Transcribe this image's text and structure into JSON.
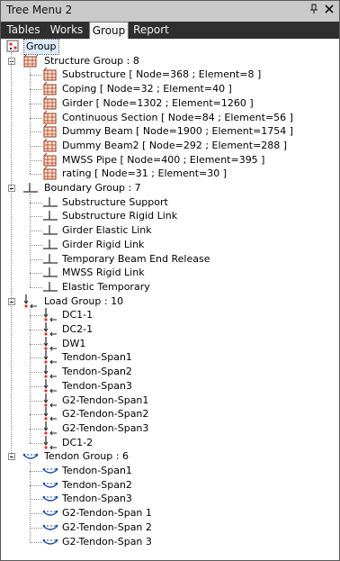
{
  "window": {
    "title": "Tree Menu 2",
    "pin_icon": "pin-icon",
    "close_icon": "close-icon"
  },
  "tabs": [
    {
      "label": "Tables",
      "active": false
    },
    {
      "label": "Works",
      "active": false
    },
    {
      "label": "Group",
      "active": true
    },
    {
      "label": "Report",
      "active": false
    }
  ],
  "tree": {
    "root": {
      "label": "Group",
      "icon": "group-root-icon"
    },
    "groups": [
      {
        "label": "Structure Group : 8",
        "icon": "structure-group-icon",
        "items": [
          "Substructure [ Node=368 ; Element=8 ]",
          "Coping [ Node=32 ; Element=40 ]",
          "Girder [ Node=1302 ; Element=1260 ]",
          "Continuous Section [ Node=84 ; Element=56 ]",
          "Dummy Beam [ Node=1900 ; Element=1754 ]",
          "Dummy Beam2 [ Node=292 ; Element=288 ]",
          "MWSS Pipe [ Node=400 ; Element=395 ]",
          "rating [ Node=31 ; Element=30 ]"
        ]
      },
      {
        "label": "Boundary Group : 7",
        "icon": "boundary-group-icon",
        "items": [
          "Substructure Support",
          "Substructure Rigid Link",
          "Girder Elastic Link",
          "Girder Rigid Link",
          "Temporary Beam End Release",
          "MWSS Rigid Link",
          "Elastic Temporary"
        ]
      },
      {
        "label": "Load Group : 10",
        "icon": "load-group-icon",
        "items": [
          "DC1-1",
          "DC2-1",
          "DW1",
          "Tendon-Span1",
          "Tendon-Span2",
          "Tendon-Span3",
          "G2-Tendon-Span1",
          "G2-Tendon-Span2",
          "G2-Tendon-Span3",
          "DC1-2"
        ]
      },
      {
        "label": "Tendon Group : 6",
        "icon": "tendon-group-icon",
        "items": [
          "Tendon-Span1",
          "Tendon-Span2",
          "Tendon-Span3",
          "G2-Tendon-Span 1",
          "G2-Tendon-Span 2",
          "G2-Tendon-Span 3"
        ]
      }
    ]
  }
}
